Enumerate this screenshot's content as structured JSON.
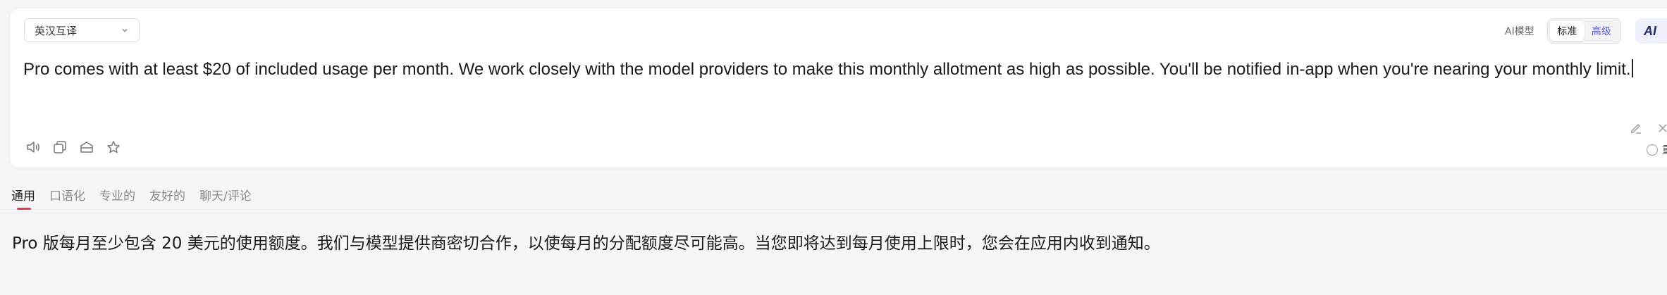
{
  "language_select": {
    "label": "英汉互译",
    "icon": "chevron-down-icon"
  },
  "model": {
    "label": "AI模型",
    "modes": [
      "标准",
      "高级"
    ],
    "active_mode": "标准"
  },
  "ai_chip": {
    "label": "AI"
  },
  "source": {
    "text": "Pro comes with at least $20 of included usage per month. We work closely with the model providers to make this monthly allotment as high as possible. You'll be notified in-app when you're nearing your monthly limit."
  },
  "toolbar_icons": [
    "speaker-icon",
    "copy-icon",
    "book-icon",
    "star-icon"
  ],
  "edit_icons": [
    "edit-icon",
    "close-icon"
  ],
  "radio": {
    "label": "重点"
  },
  "tabs": [
    "通用",
    "口语化",
    "专业的",
    "友好的",
    "聊天/评论"
  ],
  "active_tab": "通用",
  "result": {
    "text": "Pro 版每月至少包含 20 美元的使用额度。我们与模型提供商密切合作，以使每月的分配额度尽可能高。当您即将达到每月使用上限时，您会在应用内收到通知。"
  },
  "colors": {
    "accent": "#e23d3d",
    "mode_alt": "#5b5bd6",
    "background": "#f6f6f8"
  }
}
